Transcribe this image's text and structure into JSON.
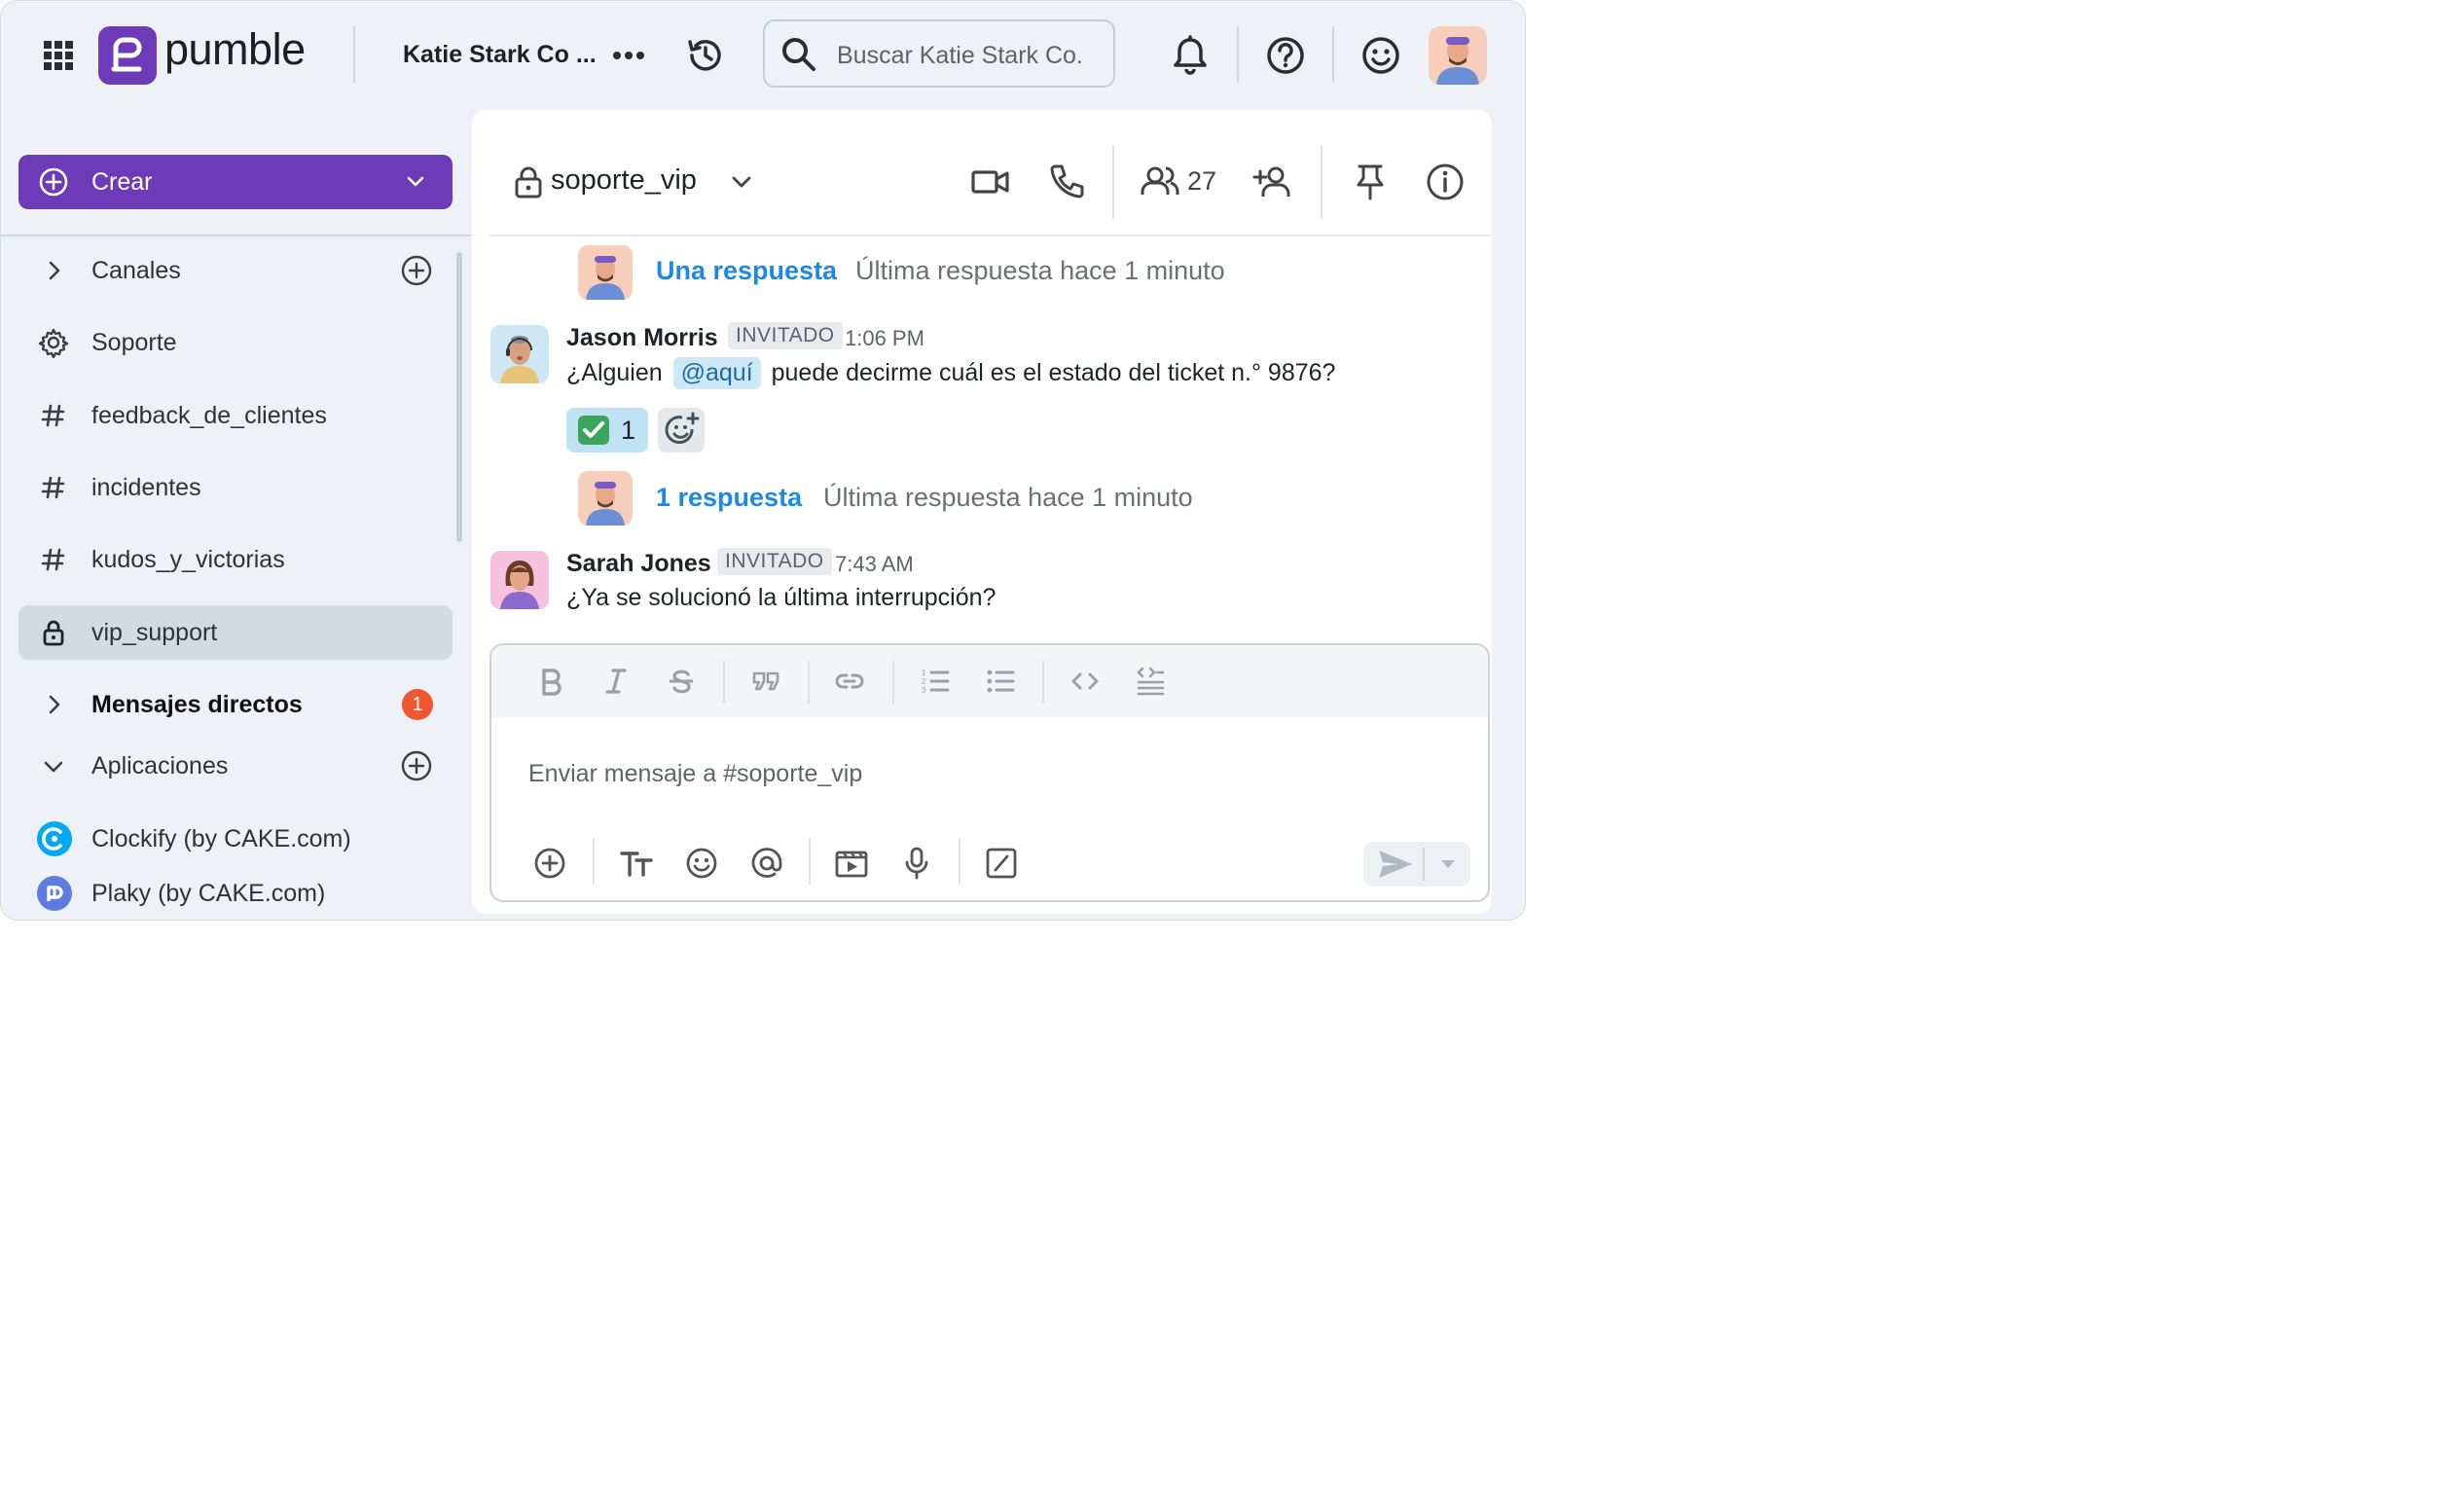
{
  "topbar": {
    "brand": "pumble",
    "workspace_name": "Katie Stark Co ...",
    "search_placeholder": "Buscar Katie Stark Co."
  },
  "sidebar": {
    "create_label": "Crear",
    "items": [
      {
        "label": "Canales",
        "icon": "chevron-right-icon"
      },
      {
        "label": "Soporte",
        "icon": "gear-icon"
      },
      {
        "label": "feedback_de_clientes",
        "icon": "hash-icon"
      },
      {
        "label": "incidentes",
        "icon": "hash-icon"
      },
      {
        "label": "kudos_y_victorias",
        "icon": "hash-icon"
      },
      {
        "label": "vip_support",
        "icon": "lock-icon"
      },
      {
        "label": "Mensajes directos",
        "icon": "chevron-right-icon"
      },
      {
        "label": "Aplicaciones",
        "icon": "chevron-down-icon"
      },
      {
        "label": "Clockify (by CAKE.com)",
        "icon": "clockify-icon"
      },
      {
        "label": "Plaky (by CAKE.com)",
        "icon": "plaky-icon"
      }
    ],
    "dm_badge": "1"
  },
  "channel": {
    "name": "soporte_vip",
    "member_count": "27"
  },
  "messages": {
    "thread1": {
      "link": "Una respuesta",
      "meta": "Última respuesta hace 1 minuto"
    },
    "msg1": {
      "author": "Jason Morris",
      "tag": "INVITADO",
      "time": "1:06 PM",
      "text_before": "¿Alguien",
      "mention": "@aquí",
      "text_after": "puede decirme cuál es el estado del ticket n.° 9876?",
      "reaction_count": "1"
    },
    "thread2": {
      "link": "1 respuesta",
      "meta": "Última respuesta hace 1 minuto"
    },
    "msg2": {
      "author": "Sarah Jones",
      "tag": "INVITADO",
      "time": "7:43 AM",
      "text": "¿Ya se solucionó la última interrupción?"
    }
  },
  "composer": {
    "placeholder": "Enviar mensaje a #soporte_vip"
  },
  "colors": {
    "brand_purple": "#6d3ab8",
    "link_blue": "#1e88e5",
    "badge_orange": "#f0562f",
    "mention_bg": "#cde8f7"
  }
}
